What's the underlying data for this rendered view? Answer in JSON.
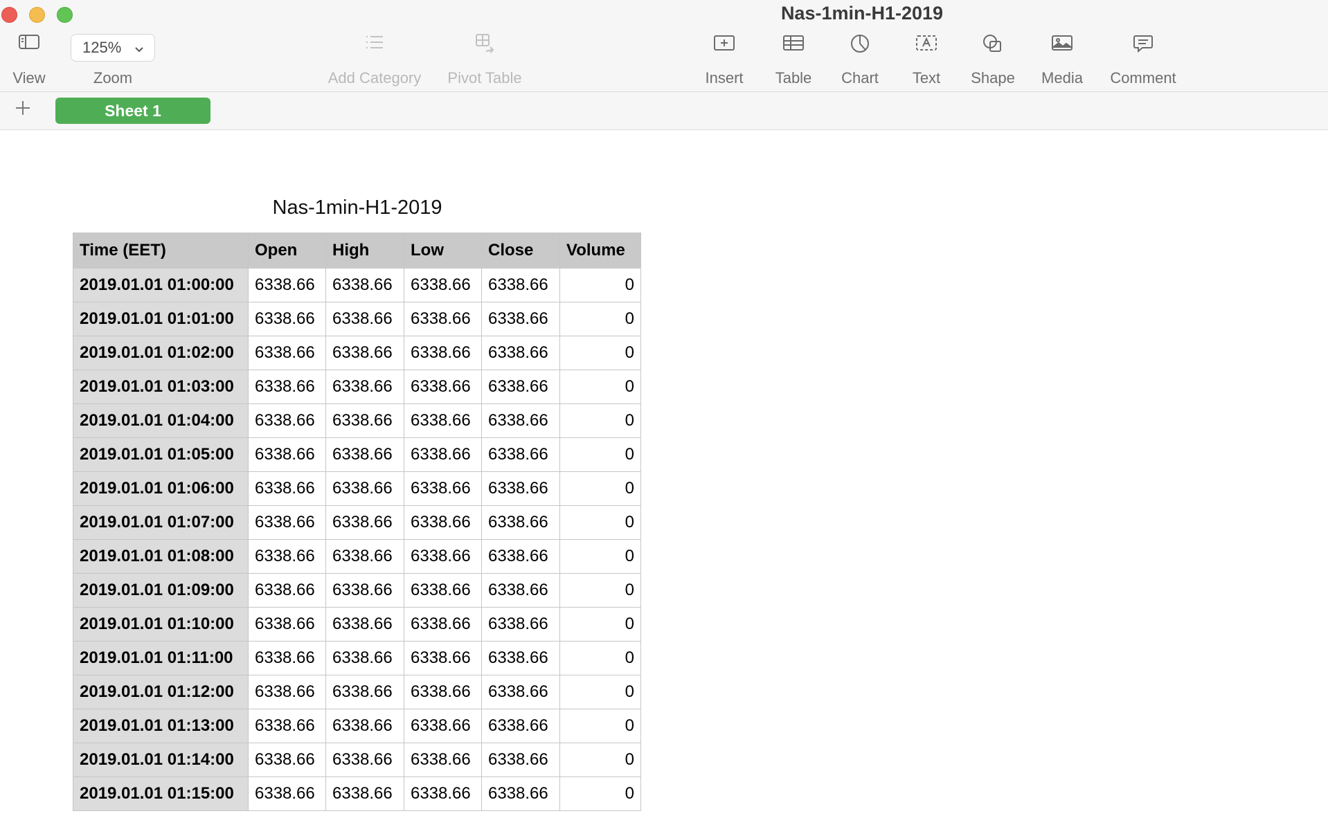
{
  "window": {
    "title": "Nas-1min-H1-2019"
  },
  "toolbar": {
    "view_label": "View",
    "zoom_value": "125%",
    "zoom_label": "Zoom",
    "add_category_label": "Add Category",
    "pivot_table_label": "Pivot Table",
    "insert_label": "Insert",
    "table_label": "Table",
    "chart_label": "Chart",
    "text_label": "Text",
    "shape_label": "Shape",
    "media_label": "Media",
    "comment_label": "Comment"
  },
  "sheets": {
    "active": "Sheet 1"
  },
  "table": {
    "title": "Nas-1min-H1-2019",
    "headers": [
      "Time (EET)",
      "Open",
      "High",
      "Low",
      "Close",
      "Volume"
    ],
    "rows": [
      [
        "2019.01.01 01:00:00",
        "6338.66",
        "6338.66",
        "6338.66",
        "6338.66",
        "0"
      ],
      [
        "2019.01.01 01:01:00",
        "6338.66",
        "6338.66",
        "6338.66",
        "6338.66",
        "0"
      ],
      [
        "2019.01.01 01:02:00",
        "6338.66",
        "6338.66",
        "6338.66",
        "6338.66",
        "0"
      ],
      [
        "2019.01.01 01:03:00",
        "6338.66",
        "6338.66",
        "6338.66",
        "6338.66",
        "0"
      ],
      [
        "2019.01.01 01:04:00",
        "6338.66",
        "6338.66",
        "6338.66",
        "6338.66",
        "0"
      ],
      [
        "2019.01.01 01:05:00",
        "6338.66",
        "6338.66",
        "6338.66",
        "6338.66",
        "0"
      ],
      [
        "2019.01.01 01:06:00",
        "6338.66",
        "6338.66",
        "6338.66",
        "6338.66",
        "0"
      ],
      [
        "2019.01.01 01:07:00",
        "6338.66",
        "6338.66",
        "6338.66",
        "6338.66",
        "0"
      ],
      [
        "2019.01.01 01:08:00",
        "6338.66",
        "6338.66",
        "6338.66",
        "6338.66",
        "0"
      ],
      [
        "2019.01.01 01:09:00",
        "6338.66",
        "6338.66",
        "6338.66",
        "6338.66",
        "0"
      ],
      [
        "2019.01.01 01:10:00",
        "6338.66",
        "6338.66",
        "6338.66",
        "6338.66",
        "0"
      ],
      [
        "2019.01.01 01:11:00",
        "6338.66",
        "6338.66",
        "6338.66",
        "6338.66",
        "0"
      ],
      [
        "2019.01.01 01:12:00",
        "6338.66",
        "6338.66",
        "6338.66",
        "6338.66",
        "0"
      ],
      [
        "2019.01.01 01:13:00",
        "6338.66",
        "6338.66",
        "6338.66",
        "6338.66",
        "0"
      ],
      [
        "2019.01.01 01:14:00",
        "6338.66",
        "6338.66",
        "6338.66",
        "6338.66",
        "0"
      ],
      [
        "2019.01.01 01:15:00",
        "6338.66",
        "6338.66",
        "6338.66",
        "6338.66",
        "0"
      ]
    ]
  }
}
